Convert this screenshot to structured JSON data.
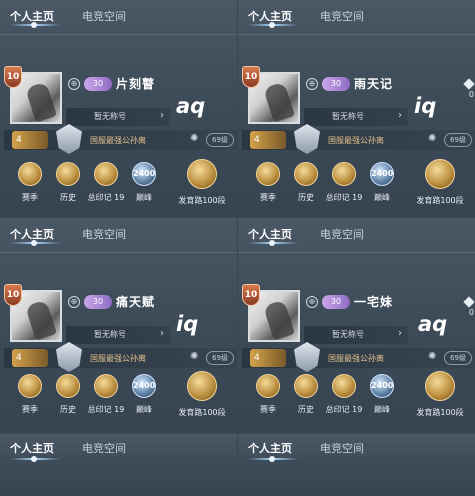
{
  "tabs": {
    "active": "个人主页",
    "other": "电竞空间"
  },
  "panels": [
    {
      "name": "片刻瞽",
      "vip": "30",
      "level": "10",
      "note": "aq",
      "title_text": "暂无称号",
      "bar_medal": "4",
      "bar_label": "国服最强公孙离",
      "bar_tag": "69级",
      "stats": [
        "赛季",
        "历史",
        "总印记 19",
        "巅峰",
        "发育路100段"
      ]
    },
    {
      "name": "雨天记",
      "vip": "30",
      "level": "10",
      "note": "iq",
      "title_text": "暂无称号",
      "bar_medal": "4",
      "bar_label": "国服最强公孙离",
      "bar_tag": "69级",
      "stats": [
        "赛季",
        "历史",
        "总印记 19",
        "巅峰",
        "发育路100段"
      ]
    },
    {
      "name": "痛天赋",
      "vip": "30",
      "level": "10",
      "note": "iq",
      "title_text": "暂无称号",
      "bar_medal": "4",
      "bar_label": "国服最强公孙离",
      "bar_tag": "69级",
      "stats": [
        "赛季",
        "历史",
        "总印记 19",
        "巅峰",
        "发育路100段"
      ]
    },
    {
      "name": "一宅妹",
      "vip": "30",
      "level": "10",
      "note": "aq",
      "title_text": "暂无称号",
      "bar_medal": "4",
      "bar_label": "国服最强公孙离",
      "bar_tag": "69级",
      "stats": [
        "赛季",
        "历史",
        "总印记 19",
        "巅峰",
        "发育路100段"
      ]
    }
  ],
  "stat_badges": {
    "peak": "2400"
  },
  "side": {
    "zero": "0"
  },
  "icons": {
    "tab_indicator": "dot-icon",
    "gear": "gear-icon",
    "chevron": "chevron-right-icon",
    "side": "diamond-icon"
  }
}
